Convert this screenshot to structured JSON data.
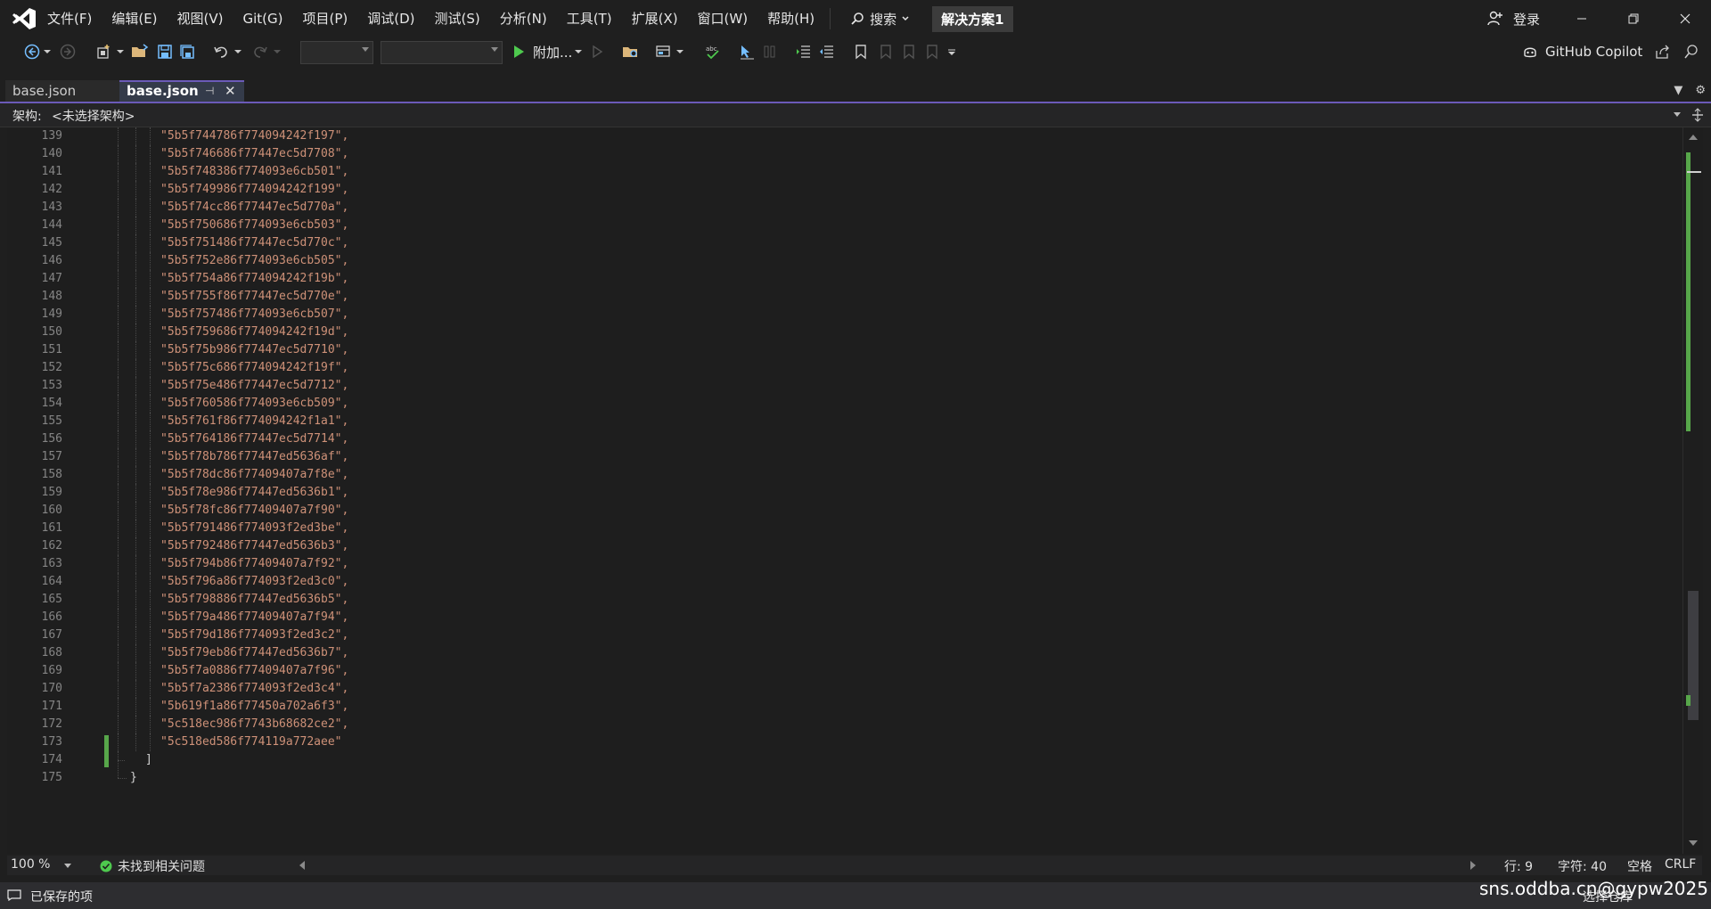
{
  "menubar": {
    "items": [
      "文件(F)",
      "编辑(E)",
      "视图(V)",
      "Git(G)",
      "项目(P)",
      "调试(D)",
      "测试(S)",
      "分析(N)",
      "工具(T)",
      "扩展(X)",
      "窗口(W)",
      "帮助(H)"
    ],
    "search_label": "搜索",
    "solution_name": "解决方案1",
    "login_label": "登录"
  },
  "toolbar": {
    "attach_label": "附加...",
    "copilot_label": "GitHub Copilot"
  },
  "tabs": [
    {
      "label": "base.json",
      "active": false
    },
    {
      "label": "base.json",
      "active": true
    }
  ],
  "navbar": {
    "label": "架构:",
    "value": "<未选择架构>"
  },
  "editor": {
    "lines": [
      {
        "n": "139",
        "text": "\"5b5f744786f774094242f197\","
      },
      {
        "n": "140",
        "text": "\"5b5f746686f77447ec5d7708\","
      },
      {
        "n": "141",
        "text": "\"5b5f748386f774093e6cb501\","
      },
      {
        "n": "142",
        "text": "\"5b5f749986f774094242f199\","
      },
      {
        "n": "143",
        "text": "\"5b5f74cc86f77447ec5d770a\","
      },
      {
        "n": "144",
        "text": "\"5b5f750686f774093e6cb503\","
      },
      {
        "n": "145",
        "text": "\"5b5f751486f77447ec5d770c\","
      },
      {
        "n": "146",
        "text": "\"5b5f752e86f774093e6cb505\","
      },
      {
        "n": "147",
        "text": "\"5b5f754a86f774094242f19b\","
      },
      {
        "n": "148",
        "text": "\"5b5f755f86f77447ec5d770e\","
      },
      {
        "n": "149",
        "text": "\"5b5f757486f774093e6cb507\","
      },
      {
        "n": "150",
        "text": "\"5b5f759686f774094242f19d\","
      },
      {
        "n": "151",
        "text": "\"5b5f75b986f77447ec5d7710\","
      },
      {
        "n": "152",
        "text": "\"5b5f75c686f774094242f19f\","
      },
      {
        "n": "153",
        "text": "\"5b5f75e486f77447ec5d7712\","
      },
      {
        "n": "154",
        "text": "\"5b5f760586f774093e6cb509\","
      },
      {
        "n": "155",
        "text": "\"5b5f761f86f774094242f1a1\","
      },
      {
        "n": "156",
        "text": "\"5b5f764186f77447ec5d7714\","
      },
      {
        "n": "157",
        "text": "\"5b5f78b786f77447ed5636af\","
      },
      {
        "n": "158",
        "text": "\"5b5f78dc86f77409407a7f8e\","
      },
      {
        "n": "159",
        "text": "\"5b5f78e986f77447ed5636b1\","
      },
      {
        "n": "160",
        "text": "\"5b5f78fc86f77409407a7f90\","
      },
      {
        "n": "161",
        "text": "\"5b5f791486f774093f2ed3be\","
      },
      {
        "n": "162",
        "text": "\"5b5f792486f77447ed5636b3\","
      },
      {
        "n": "163",
        "text": "\"5b5f794b86f77409407a7f92\","
      },
      {
        "n": "164",
        "text": "\"5b5f796a86f774093f2ed3c0\","
      },
      {
        "n": "165",
        "text": "\"5b5f798886f77447ed5636b5\","
      },
      {
        "n": "166",
        "text": "\"5b5f79a486f77409407a7f94\","
      },
      {
        "n": "167",
        "text": "\"5b5f79d186f774093f2ed3c2\","
      },
      {
        "n": "168",
        "text": "\"5b5f79eb86f77447ed5636b7\","
      },
      {
        "n": "169",
        "text": "\"5b5f7a0886f77409407a7f96\","
      },
      {
        "n": "170",
        "text": "\"5b5f7a2386f774093f2ed3c4\","
      },
      {
        "n": "171",
        "text": "\"5b619f1a86f77450a702a6f3\","
      },
      {
        "n": "172",
        "text": "\"5c518ec986f7743b68682ce2\","
      },
      {
        "n": "173",
        "text": "\"5c518ed586f774119a772aee\""
      },
      {
        "n": "174",
        "text": "]"
      },
      {
        "n": "175",
        "text": "}"
      }
    ]
  },
  "status": {
    "zoom": "100 %",
    "issues": "未找到相关问题",
    "row": "行: 9",
    "char": "字符: 40",
    "whitespace": "空格",
    "line_ending": "CRLF"
  },
  "bottombar": {
    "saved": "已保存的项",
    "source_control": "选择仓库"
  },
  "watermark": "sns.oddba.cn@gypw2025",
  "colors": {
    "accent": "#6b5ab8",
    "string": "#ce9178",
    "change_marker": "#57a64a"
  }
}
